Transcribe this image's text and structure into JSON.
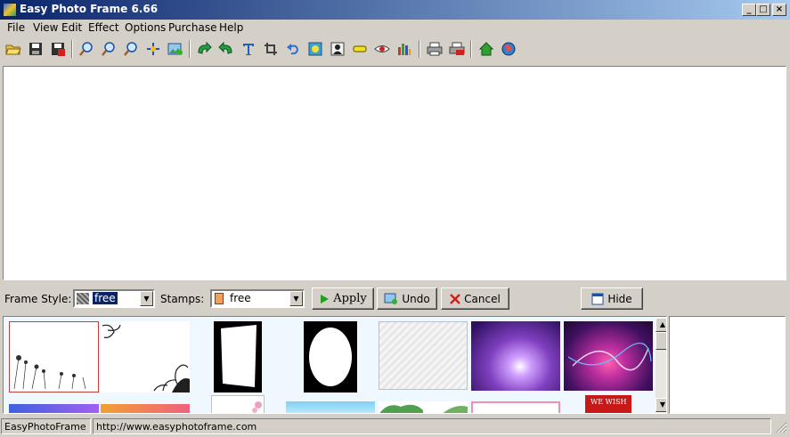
{
  "window": {
    "title": "Easy Photo Frame 6.66"
  },
  "menu": [
    "File",
    "View",
    "Edit",
    "Effect",
    "Options",
    "Purchase",
    "Help"
  ],
  "toolbar": {
    "icons": [
      "open-icon",
      "save-icon",
      "save-as-icon",
      "zoom-in-icon",
      "zoom-out-icon",
      "zoom-fit-icon",
      "pan-icon",
      "insert-image-icon",
      "rotate-left-icon",
      "rotate-right-icon",
      "text-icon",
      "crop-icon",
      "undo-icon",
      "adjust-icon",
      "portrait-icon",
      "highlight-icon",
      "red-eye-icon",
      "levels-icon",
      "print-icon",
      "print-setup-icon",
      "home-icon",
      "web-icon"
    ]
  },
  "controls": {
    "frame_style_label": "Frame Style:",
    "frame_style_value": "free",
    "stamps_label": "Stamps:",
    "stamps_value": "free",
    "apply_label": "Apply",
    "undo_label": "Undo",
    "cancel_label": "Cancel",
    "hide_label": "Hide"
  },
  "thumbs": {
    "wish_text": "WE WISH"
  },
  "status": {
    "app": "EasyPhotoFrame",
    "url": "http://www.easyphotoframe.com"
  },
  "colors": {
    "title_start": "#0a246a",
    "title_end": "#a6caf0",
    "face": "#d4d0c8",
    "selection": "#0a246a"
  }
}
